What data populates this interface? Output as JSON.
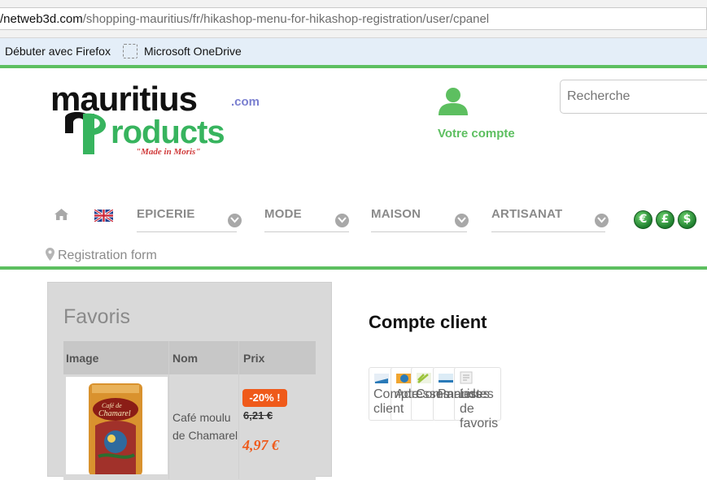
{
  "browser": {
    "url_host": "/netweb3d.com",
    "url_path": "/shopping-mauritius/fr/hikashop-menu-for-hikashop-registration/user/cpanel",
    "bookmarks": [
      "Débuter avec Firefox",
      "Microsoft OneDrive"
    ]
  },
  "header": {
    "logo_text": "mauritius products .com",
    "logo_tagline": "\"Made in Moris\"",
    "account_label": "Votre compte",
    "search_placeholder": "Recherche"
  },
  "menu": {
    "items": [
      "EPICERIE",
      "MODE",
      "MAISON",
      "ARTISANAT"
    ],
    "currencies": [
      "€",
      "£",
      "$"
    ]
  },
  "breadcrumb": "Registration form",
  "favoris": {
    "title": "Favoris",
    "columns": [
      "Image",
      "Nom",
      "Prix"
    ],
    "rows": [
      {
        "name": "Café moulu de Chamarel",
        "discount": "-20% !",
        "old_price": "6,21 €",
        "new_price": "4,97 €"
      }
    ]
  },
  "account": {
    "title": "Compte client",
    "tiles": [
      "Compte client",
      "Adresses",
      "Commandes",
      "Paniers",
      "Listes de favoris"
    ]
  },
  "colors": {
    "accent_green": "#5dbf60",
    "discount_orange": "#ef5a1a",
    "menu_grey": "#8a8a8a"
  }
}
